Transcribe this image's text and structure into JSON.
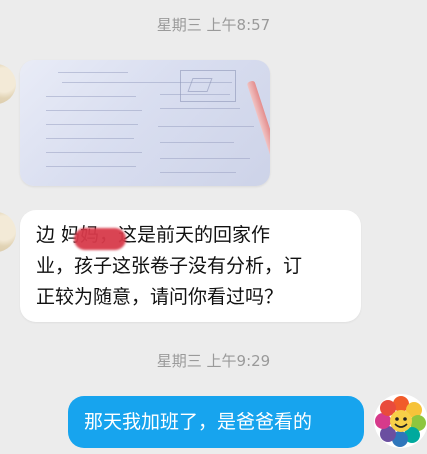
{
  "chat": {
    "timestamp_1": "星期三 上午8:57",
    "message_text_lines": [
      "边  妈妈，这是前天的回家作",
      "业，孩子这张卷子没有分析，订",
      "正较为随意，请问你看过吗？"
    ],
    "timestamp_2": "星期三 上午9:29",
    "reply_text": "那天我加班了，是爸爸看的"
  },
  "colors": {
    "background": "#ececec",
    "incoming_bubble": "#ffffff",
    "outgoing_bubble": "#17a4ee",
    "timestamp": "#9a9a9a",
    "redaction": "#d83a4a"
  },
  "icons": {
    "left_avatar": "contact-avatar",
    "right_avatar": "flower-avatar"
  }
}
